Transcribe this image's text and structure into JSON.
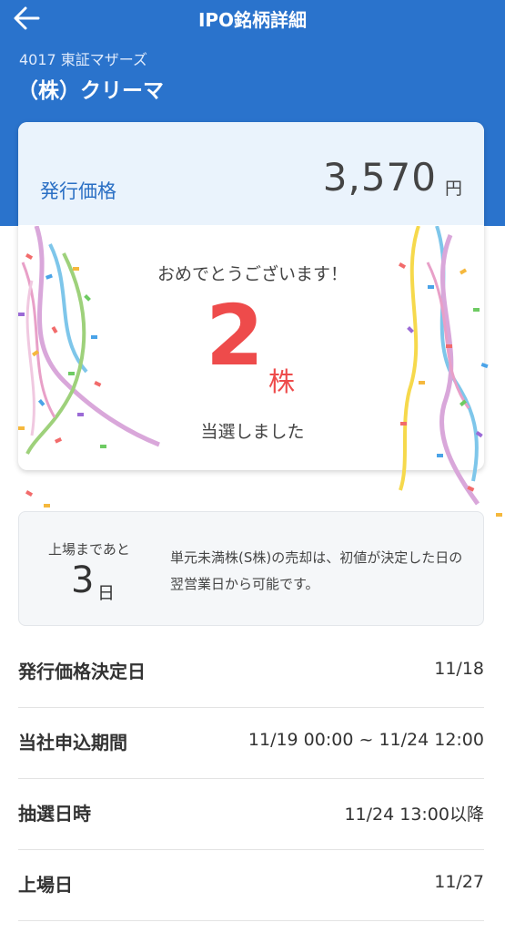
{
  "header": {
    "title": "IPO銘柄詳細",
    "back_icon": "arrow-left-icon"
  },
  "stock": {
    "code_market": "4017 東証マザーズ",
    "name": "（株）クリーマ"
  },
  "price": {
    "label": "発行価格",
    "value": "3,570",
    "unit": "円"
  },
  "result": {
    "congrats": "おめでとうございます！",
    "count": "2",
    "unit": "株",
    "message": "当選しました"
  },
  "listing": {
    "label": "上場まであと",
    "days": "3",
    "days_unit": "日",
    "note": "単元未満株(S株)の売却は、初値が決定した日の翌営業日から可能です。"
  },
  "details": [
    {
      "label": "発行価格決定日",
      "value": "11/18"
    },
    {
      "label": "当社申込期間",
      "value": "11/19 00:00 ~ 11/24 12:00"
    },
    {
      "label": "抽選日時",
      "value": "11/24 13:00以降"
    },
    {
      "label": "上場日",
      "value": "11/27"
    }
  ],
  "colors": {
    "header": "#2a73cc",
    "accent_red": "#ee4b4b",
    "price_band": "#eaf3fc",
    "label_blue": "#2a6fc4"
  }
}
